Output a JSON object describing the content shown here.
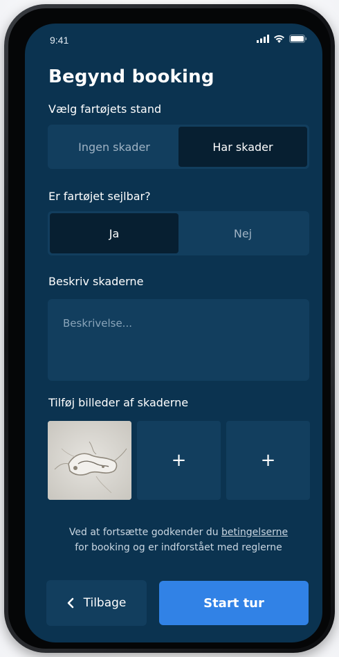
{
  "status_bar": {
    "time": "9:41"
  },
  "screen": {
    "title": "Begynd booking"
  },
  "condition": {
    "label": "Vælg fartøjets stand",
    "options": [
      "Ingen skader",
      "Har skader"
    ],
    "selected": "Har skader"
  },
  "seaworthy": {
    "label": "Er fartøjet sejlbar?",
    "options": [
      "Ja",
      "Nej"
    ],
    "selected": "Ja"
  },
  "description": {
    "label": "Beskriv skaderne",
    "placeholder": "Beskrivelse...",
    "value": ""
  },
  "photos": {
    "label": "Tilføj billeder af skaderne",
    "add_symbol": "+"
  },
  "terms": {
    "prefix": "Ved at fortsætte godkender du ",
    "link_text": "betingelserne",
    "suffix": "for booking og er indforstået med reglerne"
  },
  "actions": {
    "back_icon": "chevron-left-icon",
    "back_label": "Tilbage",
    "start_label": "Start tur"
  },
  "colors": {
    "background": "#0b3350",
    "surface": "#123e5e",
    "selected_segment": "#071f31",
    "primary_button": "#3182e6"
  }
}
